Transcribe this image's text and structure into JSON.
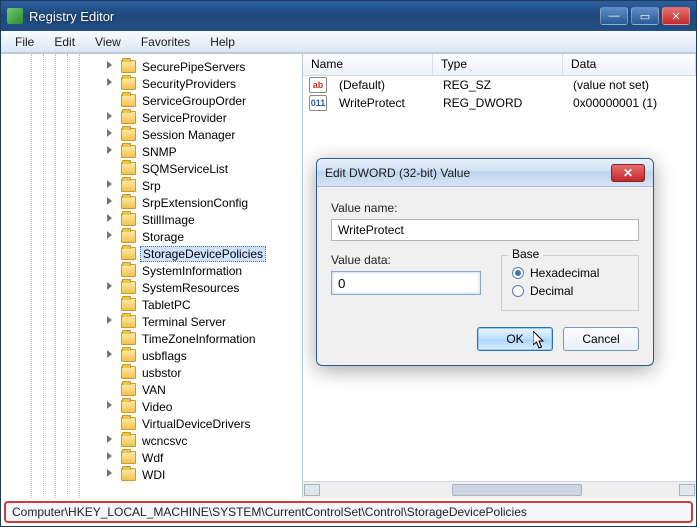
{
  "window": {
    "title": "Registry Editor"
  },
  "menu": {
    "file": "File",
    "edit": "Edit",
    "view": "View",
    "favorites": "Favorites",
    "help": "Help"
  },
  "tree": [
    {
      "label": "SecurePipeServers",
      "tw": true
    },
    {
      "label": "SecurityProviders",
      "tw": true
    },
    {
      "label": "ServiceGroupOrder"
    },
    {
      "label": "ServiceProvider",
      "tw": true
    },
    {
      "label": "Session Manager",
      "tw": true
    },
    {
      "label": "SNMP",
      "tw": true
    },
    {
      "label": "SQMServiceList"
    },
    {
      "label": "Srp",
      "tw": true
    },
    {
      "label": "SrpExtensionConfig",
      "tw": true
    },
    {
      "label": "StillImage",
      "tw": true
    },
    {
      "label": "Storage",
      "tw": true
    },
    {
      "label": "StorageDevicePolicies",
      "sel": true
    },
    {
      "label": "SystemInformation"
    },
    {
      "label": "SystemResources",
      "tw": true
    },
    {
      "label": "TabletPC"
    },
    {
      "label": "Terminal Server",
      "tw": true
    },
    {
      "label": "TimeZoneInformation"
    },
    {
      "label": "usbflags",
      "tw": true
    },
    {
      "label": "usbstor"
    },
    {
      "label": "VAN"
    },
    {
      "label": "Video",
      "tw": true
    },
    {
      "label": "VirtualDeviceDrivers"
    },
    {
      "label": "wcncsvc",
      "tw": true
    },
    {
      "label": "Wdf",
      "tw": true
    },
    {
      "label": "WDI",
      "tw": true
    }
  ],
  "list": {
    "headers": {
      "name": "Name",
      "type": "Type",
      "data": "Data"
    },
    "rows": [
      {
        "icon": "str",
        "iconText": "ab",
        "name": "(Default)",
        "type": "REG_SZ",
        "data": "(value not set)"
      },
      {
        "icon": "bin",
        "iconText": "011",
        "name": "WriteProtect",
        "type": "REG_DWORD",
        "data": "0x00000001 (1)"
      }
    ]
  },
  "statusbar": "Computer\\HKEY_LOCAL_MACHINE\\SYSTEM\\CurrentControlSet\\Control\\StorageDevicePolicies",
  "dialog": {
    "title": "Edit DWORD (32-bit) Value",
    "valueNameLabel": "Value name:",
    "valueName": "WriteProtect",
    "valueDataLabel": "Value data:",
    "valueData": "0",
    "baseLabel": "Base",
    "hex": "Hexadecimal",
    "dec": "Decimal",
    "ok": "OK",
    "cancel": "Cancel"
  }
}
